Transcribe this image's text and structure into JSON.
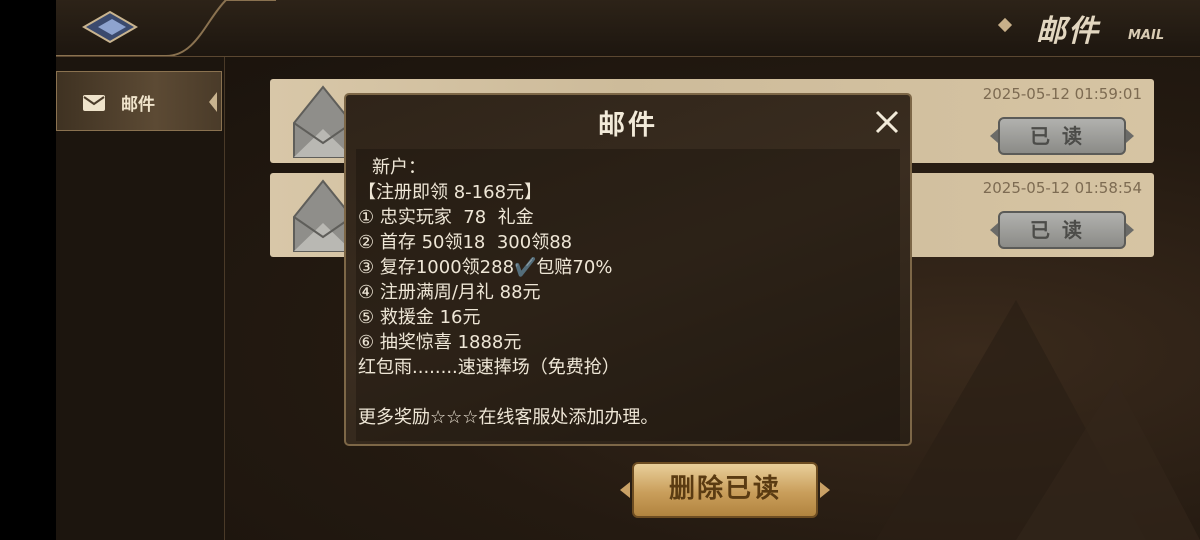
{
  "header": {
    "title": "邮件",
    "title_en": "MAIL"
  },
  "sidebar": {
    "items": [
      {
        "label": "邮件",
        "icon": "envelope-icon"
      }
    ]
  },
  "mails": [
    {
      "date": "2025-05-12 01:59:01",
      "status_button": "已读"
    },
    {
      "date": "2025-05-12 01:58:54",
      "status_button": "已读"
    }
  ],
  "actions": {
    "delete_read": "删除已读"
  },
  "modal": {
    "title": "邮件",
    "lines": [
      "新户：",
      "【注册即领 8-168元】",
      "① 忠实玩家  78  礼金",
      "② 首存 50领18  300领88",
      "③ 复存1000领288✔️包赔70%",
      "④ 注册满周/月礼 88元",
      "⑤ 救援金 16元",
      "⑥ 抽奖惊喜 1888元",
      "红包雨........速速捧场（免费抢）",
      "更多奖励☆☆☆在线客服处添加办理。"
    ]
  },
  "colors": {
    "accent_gold": "#c99e5b",
    "panel_bg": "#2f2419",
    "text_light": "#eee6d6"
  }
}
